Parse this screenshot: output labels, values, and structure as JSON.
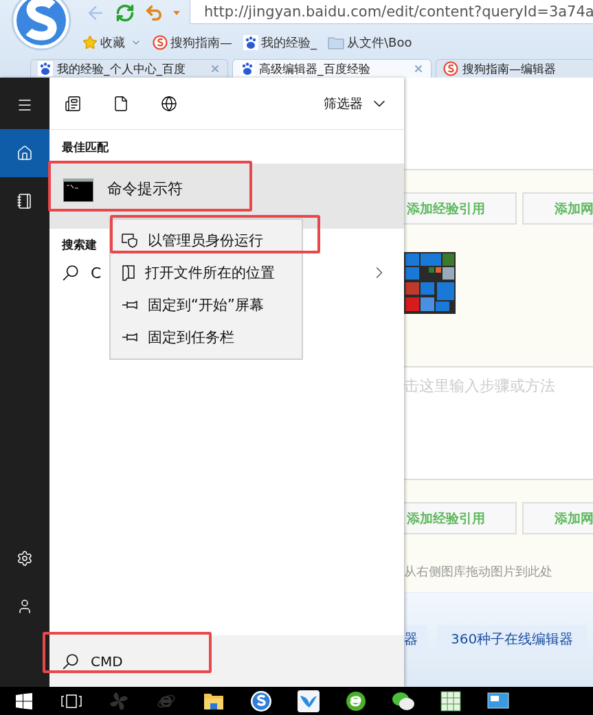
{
  "browser": {
    "address": "http://jingyan.baidu.com/edit/content?queryId=3a74a",
    "bookmarks": [
      {
        "label": "收藏",
        "kind": "favorites"
      },
      {
        "label": "搜狗指南—",
        "kind": "sogou"
      },
      {
        "label": "我的经验_",
        "kind": "baidu"
      },
      {
        "label": "从文件\\Boo",
        "kind": "folder"
      }
    ],
    "tabs": [
      {
        "label": "我的经验_个人中心_百度",
        "kind": "baidu",
        "selected": false
      },
      {
        "label": "高级编辑器_百度经验",
        "kind": "baidu",
        "selected": true
      },
      {
        "label": "搜狗指南—编辑器",
        "kind": "sogou",
        "selected": false
      }
    ]
  },
  "editor": {
    "blocks": [
      {
        "kind": "buttons",
        "buttons": [
          "添加经验引用",
          "添加网"
        ],
        "thumbnail": true
      },
      {
        "kind": "placeholder",
        "text": "击这里输入步骤或方法"
      },
      {
        "kind": "buttons",
        "buttons": [
          "添加经验引用",
          "添加网"
        ],
        "hint": "从右侧图库拖动图片到此处"
      }
    ],
    "tool_buttons": [
      "器",
      "360种子在线编辑器"
    ]
  },
  "start_menu": {
    "rail": [
      {
        "kind": "menu",
        "selected": false
      },
      {
        "kind": "home",
        "selected": true
      },
      {
        "kind": "notebook",
        "selected": false
      },
      {
        "kind": "settings",
        "selected": false
      },
      {
        "kind": "user",
        "selected": false
      }
    ],
    "filter_label": "筛选器",
    "best_match_heading": "最佳匹配",
    "best_match": {
      "title": "命令提示符",
      "selected": true,
      "highlighted": true
    },
    "suggestions_heading": "搜索建",
    "suggestions": [
      {
        "text": "C"
      }
    ],
    "search": {
      "value": "CMD",
      "highlighted": true
    }
  },
  "context_menu": {
    "items": [
      {
        "label": "以管理员身份运行",
        "kind": "shield",
        "highlighted": true
      },
      {
        "label": "打开文件所在的位置",
        "kind": "folder",
        "highlighted": false
      },
      {
        "label": "固定到“开始”屏幕",
        "kind": "pin",
        "highlighted": false
      },
      {
        "label": "固定到任务栏",
        "kind": "pin",
        "highlighted": false
      }
    ]
  },
  "taskbar": {
    "apps": [
      {
        "kind": "start"
      },
      {
        "kind": "task-view"
      },
      {
        "kind": "fan"
      },
      {
        "kind": "ie"
      },
      {
        "kind": "folder"
      },
      {
        "kind": "sogou"
      },
      {
        "kind": "bird"
      },
      {
        "kind": "green-e"
      },
      {
        "kind": "chat"
      },
      {
        "kind": "sheet"
      },
      {
        "kind": "screen"
      }
    ]
  }
}
